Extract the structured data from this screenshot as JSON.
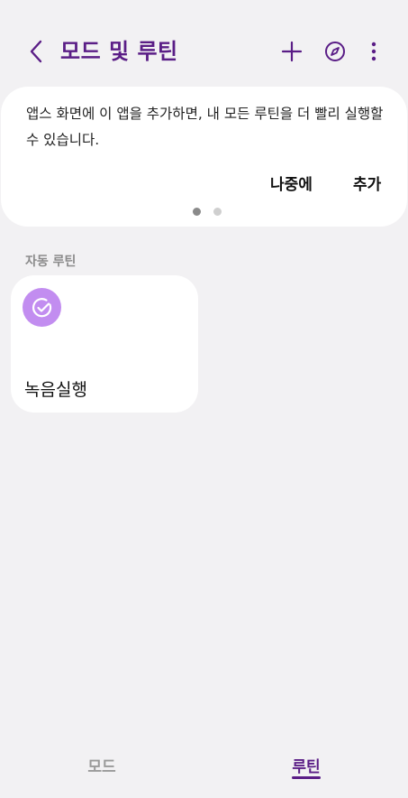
{
  "header": {
    "title": "모드 및 루틴",
    "back_icon": "chevron-left-icon",
    "add_icon": "plus-icon",
    "discover_icon": "compass-icon",
    "more_icon": "more-vertical-icon",
    "accent_color": "#5a1d86"
  },
  "banner": {
    "message": "앱스 화면에 이 앱을 추가하면, 내 모든 루틴을 더 빨리 실행할 수 있습니다.",
    "later_label": "나중에",
    "add_label": "추가",
    "page_indicator": {
      "current": 1,
      "total": 2
    }
  },
  "routines": {
    "section_label": "자동 루틴",
    "items": [
      {
        "name": "녹음실행",
        "icon": "check-circle-icon",
        "icon_color": "#c28df0"
      }
    ]
  },
  "tabs": {
    "items": [
      {
        "label": "모드",
        "selected": false
      },
      {
        "label": "루틴",
        "selected": true
      }
    ]
  }
}
